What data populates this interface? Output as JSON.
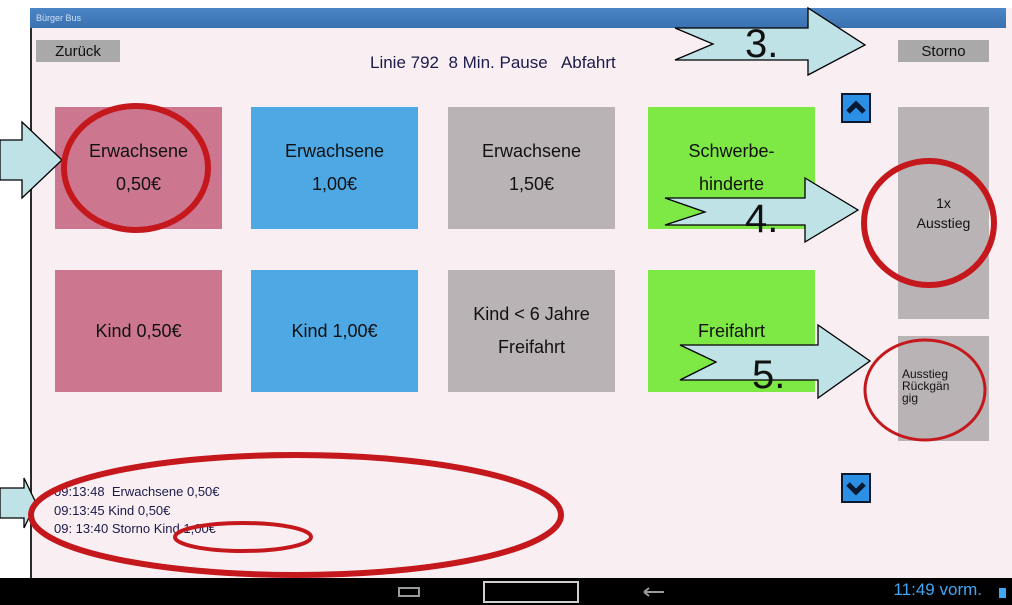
{
  "window": {
    "title": "Bürger Bus"
  },
  "toolbar": {
    "back_label": "Zurück",
    "cancel_label": "Storno"
  },
  "header": {
    "line": "Linie 792",
    "pause": "8 Min. Pause",
    "departure": "Abfahrt"
  },
  "tiles": [
    {
      "label": "Erwachsene\n0,50€",
      "color": "#cc778f"
    },
    {
      "label": "Erwachsene\n1,00€",
      "color": "#4ea8e3"
    },
    {
      "label": "Erwachsene\n1,50€",
      "color": "#bab3b5"
    },
    {
      "label": "Schwerbe-\nhinderte",
      "color": "#7ee845"
    },
    {
      "label": "Kind 0,50€",
      "color": "#cc778f"
    },
    {
      "label": "Kind 1,00€",
      "color": "#4ea8e3"
    },
    {
      "label": "Kind < 6 Jahre\nFreifahrt",
      "color": "#bab3b5"
    },
    {
      "label": "Freifahrt",
      "color": "#7ee845"
    }
  ],
  "side": {
    "exit_label": "1x\nAusstieg",
    "undo_label": "Ausstieg\nRückgän\ngig"
  },
  "log": [
    "09:13:48  Erwachsene 0,50€",
    "09:13:45 Kind 0,50€",
    "09: 13:40 Storno Kind 1,00€"
  ],
  "status": {
    "time": "11:49 vorm."
  },
  "annotations": [
    "3.",
    "4.",
    "5."
  ],
  "icons": [
    "chevron-up-icon",
    "chevron-down-icon",
    "back-nav-icon",
    "home-nav-icon",
    "recent-apps-icon"
  ]
}
